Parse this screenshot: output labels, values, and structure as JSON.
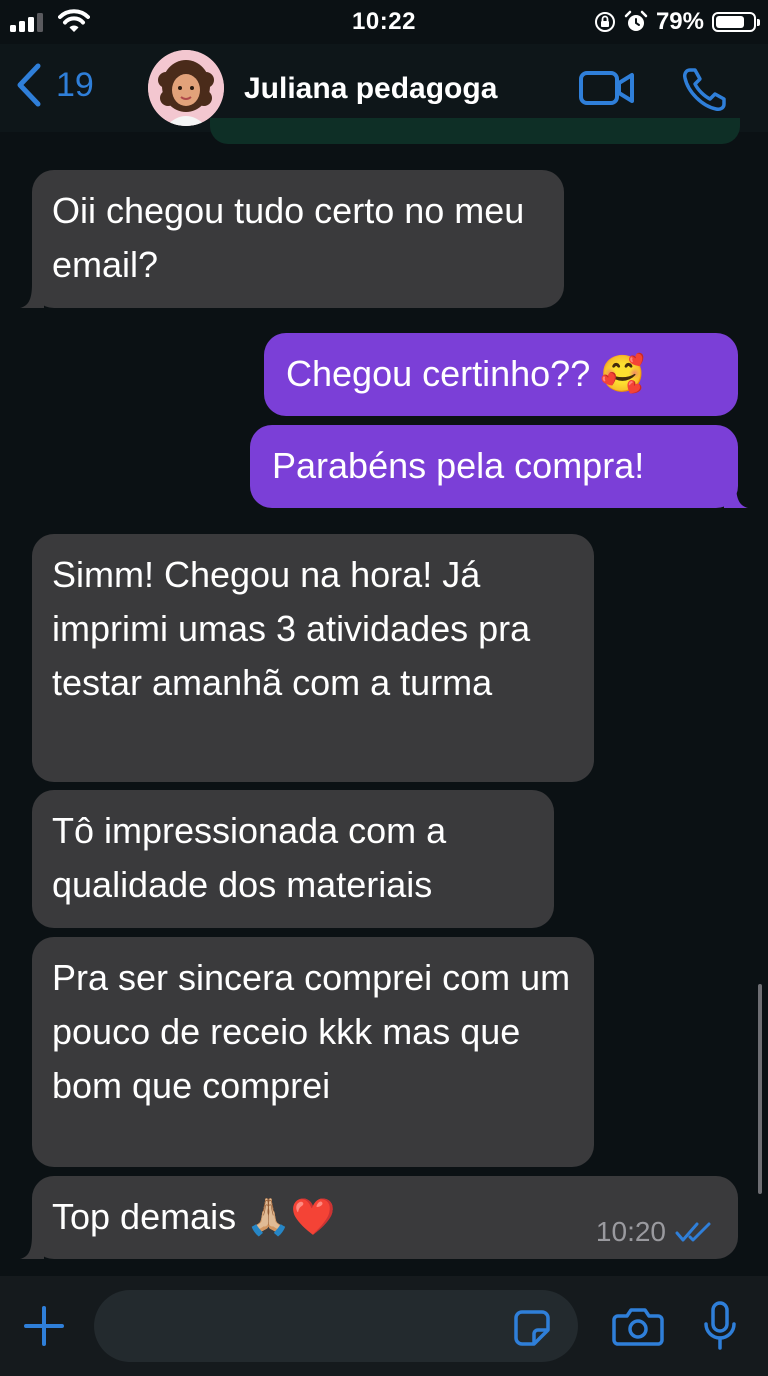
{
  "status_bar": {
    "time": "10:22",
    "battery_percent": "79%",
    "battery_level": 0.79
  },
  "header": {
    "back_count": "19",
    "contact_name": "Juliana pedagoga",
    "accent_color": "#2f7fd9"
  },
  "messages": [
    {
      "direction": "incoming",
      "text": "Oii chegou tudo certo no meu email?"
    },
    {
      "direction": "outgoing",
      "text": "Chegou certinho?? 🥰"
    },
    {
      "direction": "outgoing",
      "text": "Parabéns pela compra!"
    },
    {
      "direction": "incoming",
      "text": "Simm! Chegou na hora! Já imprimi umas 3 atividades pra testar amanhã com a turma"
    },
    {
      "direction": "incoming",
      "text": "Tô impressionada com a qualidade dos materiais"
    },
    {
      "direction": "incoming",
      "text": "Pra ser sincera comprei com um pouco de receio kkk mas que bom que comprei"
    },
    {
      "direction": "incoming",
      "text": "Top demais 🙏🏼❤️",
      "time": "10:20",
      "status": "read"
    }
  ],
  "composer": {
    "placeholder": ""
  },
  "colors": {
    "incoming_bubble": "#3a3a3c",
    "outgoing_bubble": "#7b3fd7",
    "background": "#0b1114"
  }
}
